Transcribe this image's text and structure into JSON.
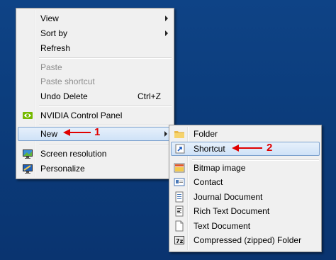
{
  "context_menu": {
    "items": [
      {
        "label": "View"
      },
      {
        "label": "Sort by"
      },
      {
        "label": "Refresh"
      },
      {
        "label": "Paste"
      },
      {
        "label": "Paste shortcut"
      },
      {
        "label": "Undo Delete",
        "shortcut": "Ctrl+Z"
      },
      {
        "label": "NVIDIA Control Panel"
      },
      {
        "label": "New"
      },
      {
        "label": "Screen resolution"
      },
      {
        "label": "Personalize"
      }
    ]
  },
  "new_submenu": {
    "items": [
      {
        "label": "Folder"
      },
      {
        "label": "Shortcut"
      },
      {
        "label": "Bitmap image"
      },
      {
        "label": "Contact"
      },
      {
        "label": "Journal Document"
      },
      {
        "label": "Rich Text Document"
      },
      {
        "label": "Text Document"
      },
      {
        "label": "Compressed (zipped) Folder"
      }
    ]
  },
  "annotations": {
    "step1": "1",
    "step2": "2"
  },
  "colors": {
    "desktop": "#0b3a78",
    "highlight_border": "#7da2ce",
    "annotation": "#e00000"
  }
}
